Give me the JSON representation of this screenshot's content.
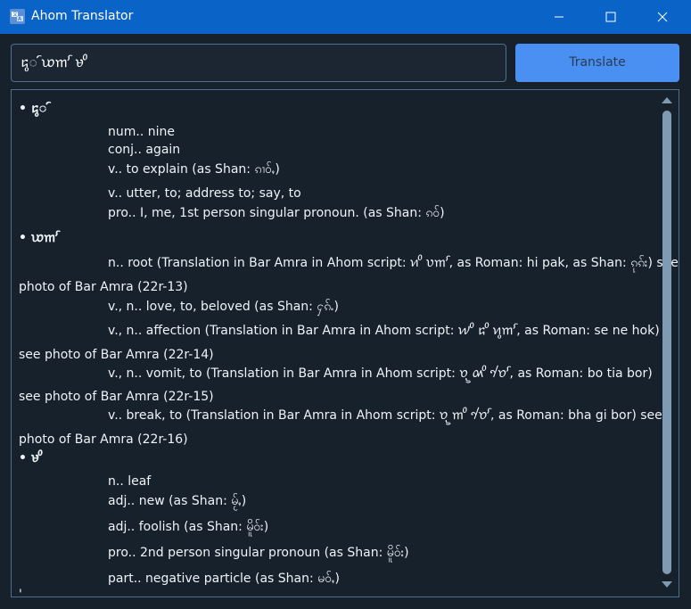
{
  "window": {
    "title": "Ahom Translator",
    "icon": "translate-icon",
    "controls": [
      "minimize-icon",
      "maximize-icon",
      "close-icon"
    ]
  },
  "search": {
    "value": "𑜃𑜨𑜫 𑜇𑜀𑜧 𑜉𑜢"
  },
  "translate_label": "Translate",
  "results": {
    "lines": [
      "• 𑜃𑜨𑜫",
      "num.. nine",
      "conj.. again",
      "v.. to explain (as Shan: ၵၢဝ်ႇ)",
      "v.. utter, to; address to; say, to",
      "pro.. I, me, 1st person singular pronoun. (as Shan: ၵဝ်)",
      "• 𑜇𑜀𑜧",
      "n.. root (Translation in Bar Amra in Ahom script: 𑜑𑜢 𑜆𑜀𑜧, as Roman: hi pak, as Shan: ၵုၵ်း)  see",
      "photo of Bar Amra (22r-13)",
      "v., n.. love, to, beloved (as Shan: ႁၵ်ႉ)",
      "v., n.. affection (Translation in Bar Amra in Ahom script: 𑜏𑜢 𑜃𑜢 𑜑𑜨𑜀𑜧, as Roman: se ne hok)",
      " see photo of Bar Amra (22r-14)",
      "v., n.. vomit, to (Translation in Bar Amra in Ahom script: 𑜈𑜥 𑜄𑜢 𑜈𑜦𑜧, as Roman: bo tia bor)",
      " see photo of Bar Amra (22r-15)",
      "v.. break, to (Translation in Bar Amra in Ahom script: 𑜈𑜥 𑜀𑜢 𑜈𑜦𑜧, as Roman: bha gi bor)  see",
      "photo of Bar Amra (22r-16)",
      "• 𑜉𑜢",
      "n.. leaf",
      "adj.. new (as Shan: မႂ်ႇ)",
      "adj.. foolish (as Shan: မိူဝ်း)",
      "pro.. 2nd person singular pronoun (as Shan: မိူဝ်း)",
      "part.. negative particle (as Shan: မဝ်ႇ)",
      "'"
    ]
  },
  "scrollbar": {
    "up_icon": "chevron-up-icon",
    "down_icon": "chevron-down-icon"
  },
  "colors": {
    "titlebar": "#0a64c8",
    "window_bg": "#17212c",
    "accent_button": "#4a8ff2",
    "border": "#4f6f8f",
    "text": "#eef3f8"
  }
}
